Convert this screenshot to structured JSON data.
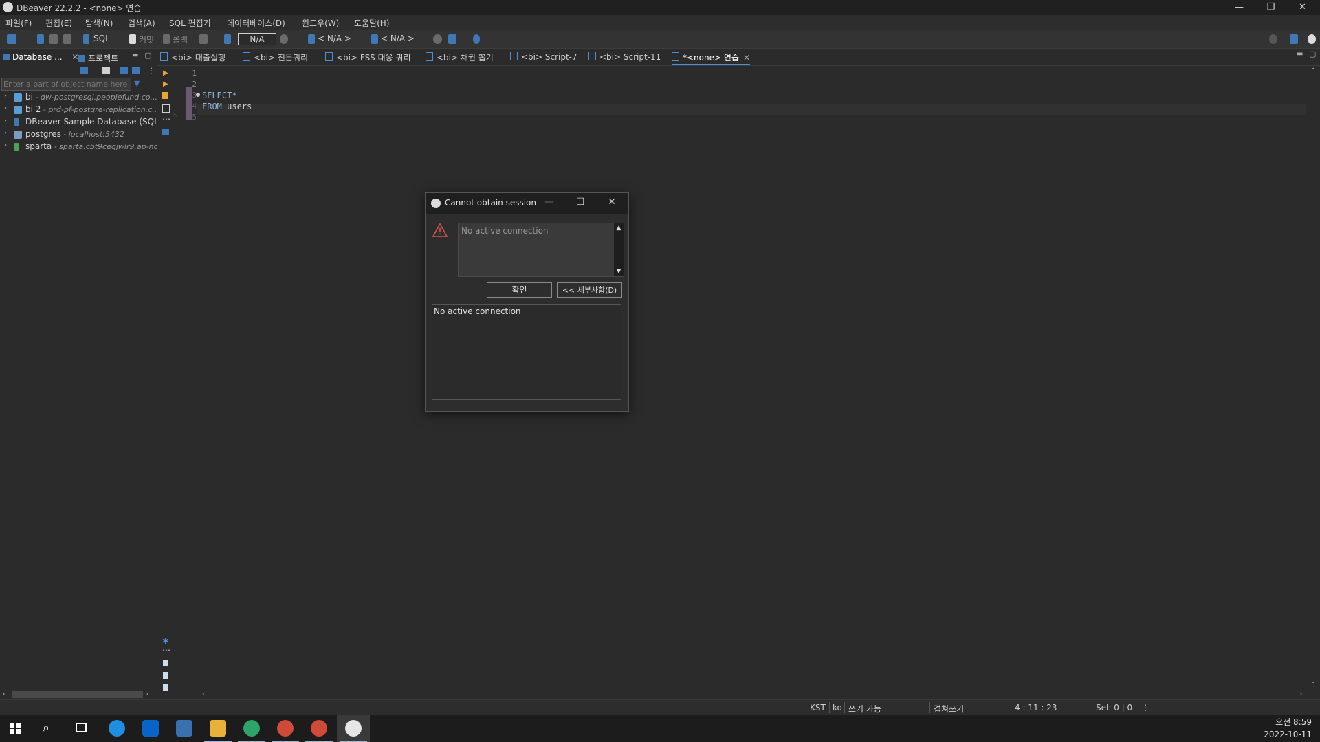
{
  "window": {
    "title": "DBeaver 22.2.2 - <none> 연습",
    "minimize_glyph": "—",
    "restore_glyph": "❐",
    "close_glyph": "✕"
  },
  "menu": [
    "파일(F)",
    "편집(E)",
    "탐색(N)",
    "검색(A)",
    "SQL 편집기",
    "데이터베이스(D)",
    "윈도우(W)",
    "도움말(H)"
  ],
  "toolbar": {
    "sql_label": "SQL",
    "commit_label": "커밋",
    "rollback_label": "롤백",
    "transaction_combo_value": "N/A",
    "datasource_selector": "< N/A >",
    "schema_selector": "< N/A >"
  },
  "left_panel": {
    "tabs": [
      "Database ...",
      "프로젝트"
    ],
    "filter_placeholder": "Enter a part of object name here",
    "connections": [
      {
        "name": "bi",
        "host": " - dw-postgresql.peoplefund.co..."
      },
      {
        "name": "bi 2",
        "host": " - prd-pf-postgre-replication.c..."
      },
      {
        "name": "DBeaver Sample Database (SQLite)",
        "host": ""
      },
      {
        "name": "postgres",
        "host": " - localhost:5432"
      },
      {
        "name": "sparta",
        "host": " - sparta.cbt9ceqjwlr9.ap-no..."
      }
    ]
  },
  "editor": {
    "tabs": [
      "<bi> 대출실행",
      "<bi> 전문쿼리",
      "<bi> FSS 대응 쿼리",
      "<bi> 채권 뽑기",
      "<bi> Script-7",
      "<bi> Script-11",
      "*<none> 연습"
    ],
    "active_tab_index": 6,
    "line_numbers": [
      "1",
      "2",
      "3",
      "4",
      "5"
    ],
    "code_line1": "SELECT*",
    "code_kw2": "FROM",
    "code_rest2": " users"
  },
  "dialog": {
    "title": "Cannot obtain session",
    "message": "No active connection",
    "ok_button": "확인",
    "details_button": "<< 세부사항(D)",
    "details_text": "No active connection"
  },
  "status_bar": {
    "timezone": "KST",
    "locale": "ko",
    "writable": "쓰기 가능",
    "insert_mode": "겹쳐쓰기",
    "cursor_position": "4 : 11 : 23",
    "selection": "Sel: 0 | 0"
  },
  "taskbar": {
    "time": "오전 8:59",
    "date": "2022-10-11"
  }
}
